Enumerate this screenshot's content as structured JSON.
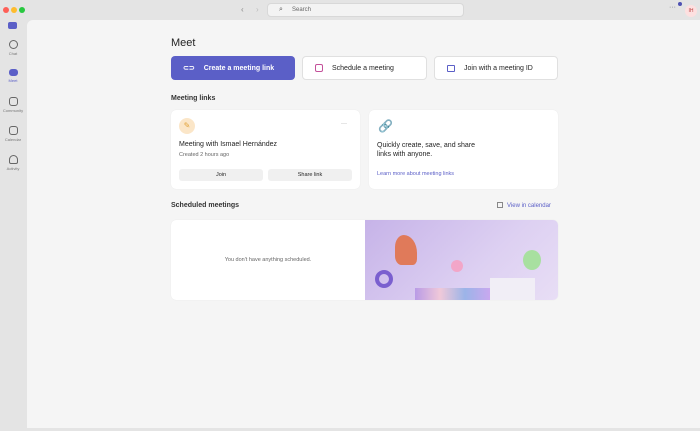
{
  "titlebar": {
    "search_placeholder": "Search",
    "more": "···",
    "avatar_initials": "IH"
  },
  "sidebar": {
    "items": [
      {
        "label": "Chat"
      },
      {
        "label": "Meet"
      },
      {
        "label": "Community"
      },
      {
        "label": "Calendar"
      },
      {
        "label": "Activity"
      }
    ]
  },
  "main": {
    "title": "Meet",
    "actions": {
      "create": "Create a meeting link",
      "schedule": "Schedule a meeting",
      "join_id": "Join with a meeting ID"
    },
    "meeting_links_heading": "Meeting links",
    "link_card": {
      "title": "Meeting with Ismael Hernández",
      "subtitle": "Created 2 hours ago",
      "more": "···",
      "join": "Join",
      "share": "Share link"
    },
    "info_card": {
      "text": "Quickly create, save, and share links with anyone.",
      "link": "Learn more about meeting links"
    },
    "scheduled_heading": "Scheduled meetings",
    "view_calendar": "View in calendar",
    "empty_text": "You don't have anything scheduled."
  },
  "colors": {
    "accent": "#5b5fc7"
  }
}
